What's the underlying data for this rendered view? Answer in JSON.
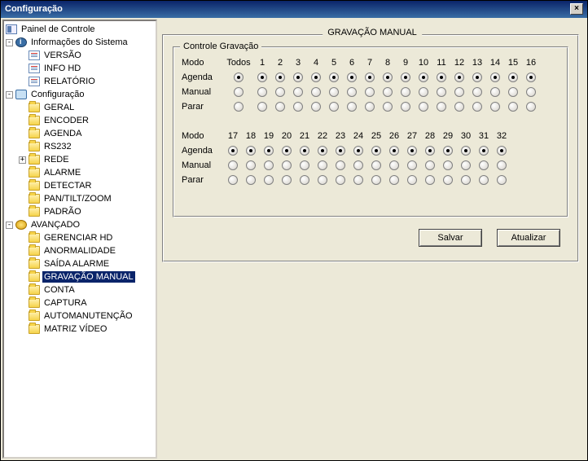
{
  "window": {
    "title": "Configuração"
  },
  "tree": {
    "root": "Painel de Controle",
    "sys": {
      "label": "Informações do Sistema",
      "items": [
        "VERSÃO",
        "INFO HD",
        "RELATÓRIO"
      ]
    },
    "cfg": {
      "label": "Configuração",
      "items": [
        "GERAL",
        "ENCODER",
        "AGENDA",
        "RS232",
        "REDE",
        "ALARME",
        "DETECTAR",
        "PAN/TILT/ZOOM",
        "PADRÃO"
      ]
    },
    "adv": {
      "label": "AVANÇADO",
      "items": [
        "GERENCIAR HD",
        "ANORMALIDADE",
        "SAÍDA ALARME",
        "GRAVAÇÃO MANUAL",
        "CONTA",
        "CAPTURA",
        "AUTOMANUTENÇÃO",
        "MATRIZ VÍDEO"
      ]
    },
    "selected": "GRAVAÇÃO MANUAL"
  },
  "panel": {
    "title": "GRAVAÇÃO MANUAL",
    "group_title": "Controle Gravação",
    "headers": {
      "mode": "Modo",
      "all": "Todos"
    },
    "rows": [
      "Agenda",
      "Manual",
      "Parar"
    ],
    "buttons": {
      "save": "Salvar",
      "refresh": "Atualizar"
    }
  },
  "chart_data": {
    "type": "table",
    "title": "Controle Gravação",
    "channels_block1": [
      1,
      2,
      3,
      4,
      5,
      6,
      7,
      8,
      9,
      10,
      11,
      12,
      13,
      14,
      15,
      16
    ],
    "channels_block2": [
      17,
      18,
      19,
      20,
      21,
      22,
      23,
      24,
      25,
      26,
      27,
      28,
      29,
      30,
      31,
      32
    ],
    "modes": [
      "Agenda",
      "Manual",
      "Parar"
    ],
    "selected_mode_all": "Agenda",
    "selection_per_channel": {
      "1": "Agenda",
      "2": "Agenda",
      "3": "Agenda",
      "4": "Agenda",
      "5": "Agenda",
      "6": "Agenda",
      "7": "Agenda",
      "8": "Agenda",
      "9": "Agenda",
      "10": "Agenda",
      "11": "Agenda",
      "12": "Agenda",
      "13": "Agenda",
      "14": "Agenda",
      "15": "Agenda",
      "16": "Agenda",
      "17": "Agenda",
      "18": "Agenda",
      "19": "Agenda",
      "20": "Agenda",
      "21": "Agenda",
      "22": "Agenda",
      "23": "Agenda",
      "24": "Agenda",
      "25": "Agenda",
      "26": "Agenda",
      "27": "Agenda",
      "28": "Agenda",
      "29": "Agenda",
      "30": "Agenda",
      "31": "Agenda",
      "32": "Agenda"
    }
  }
}
